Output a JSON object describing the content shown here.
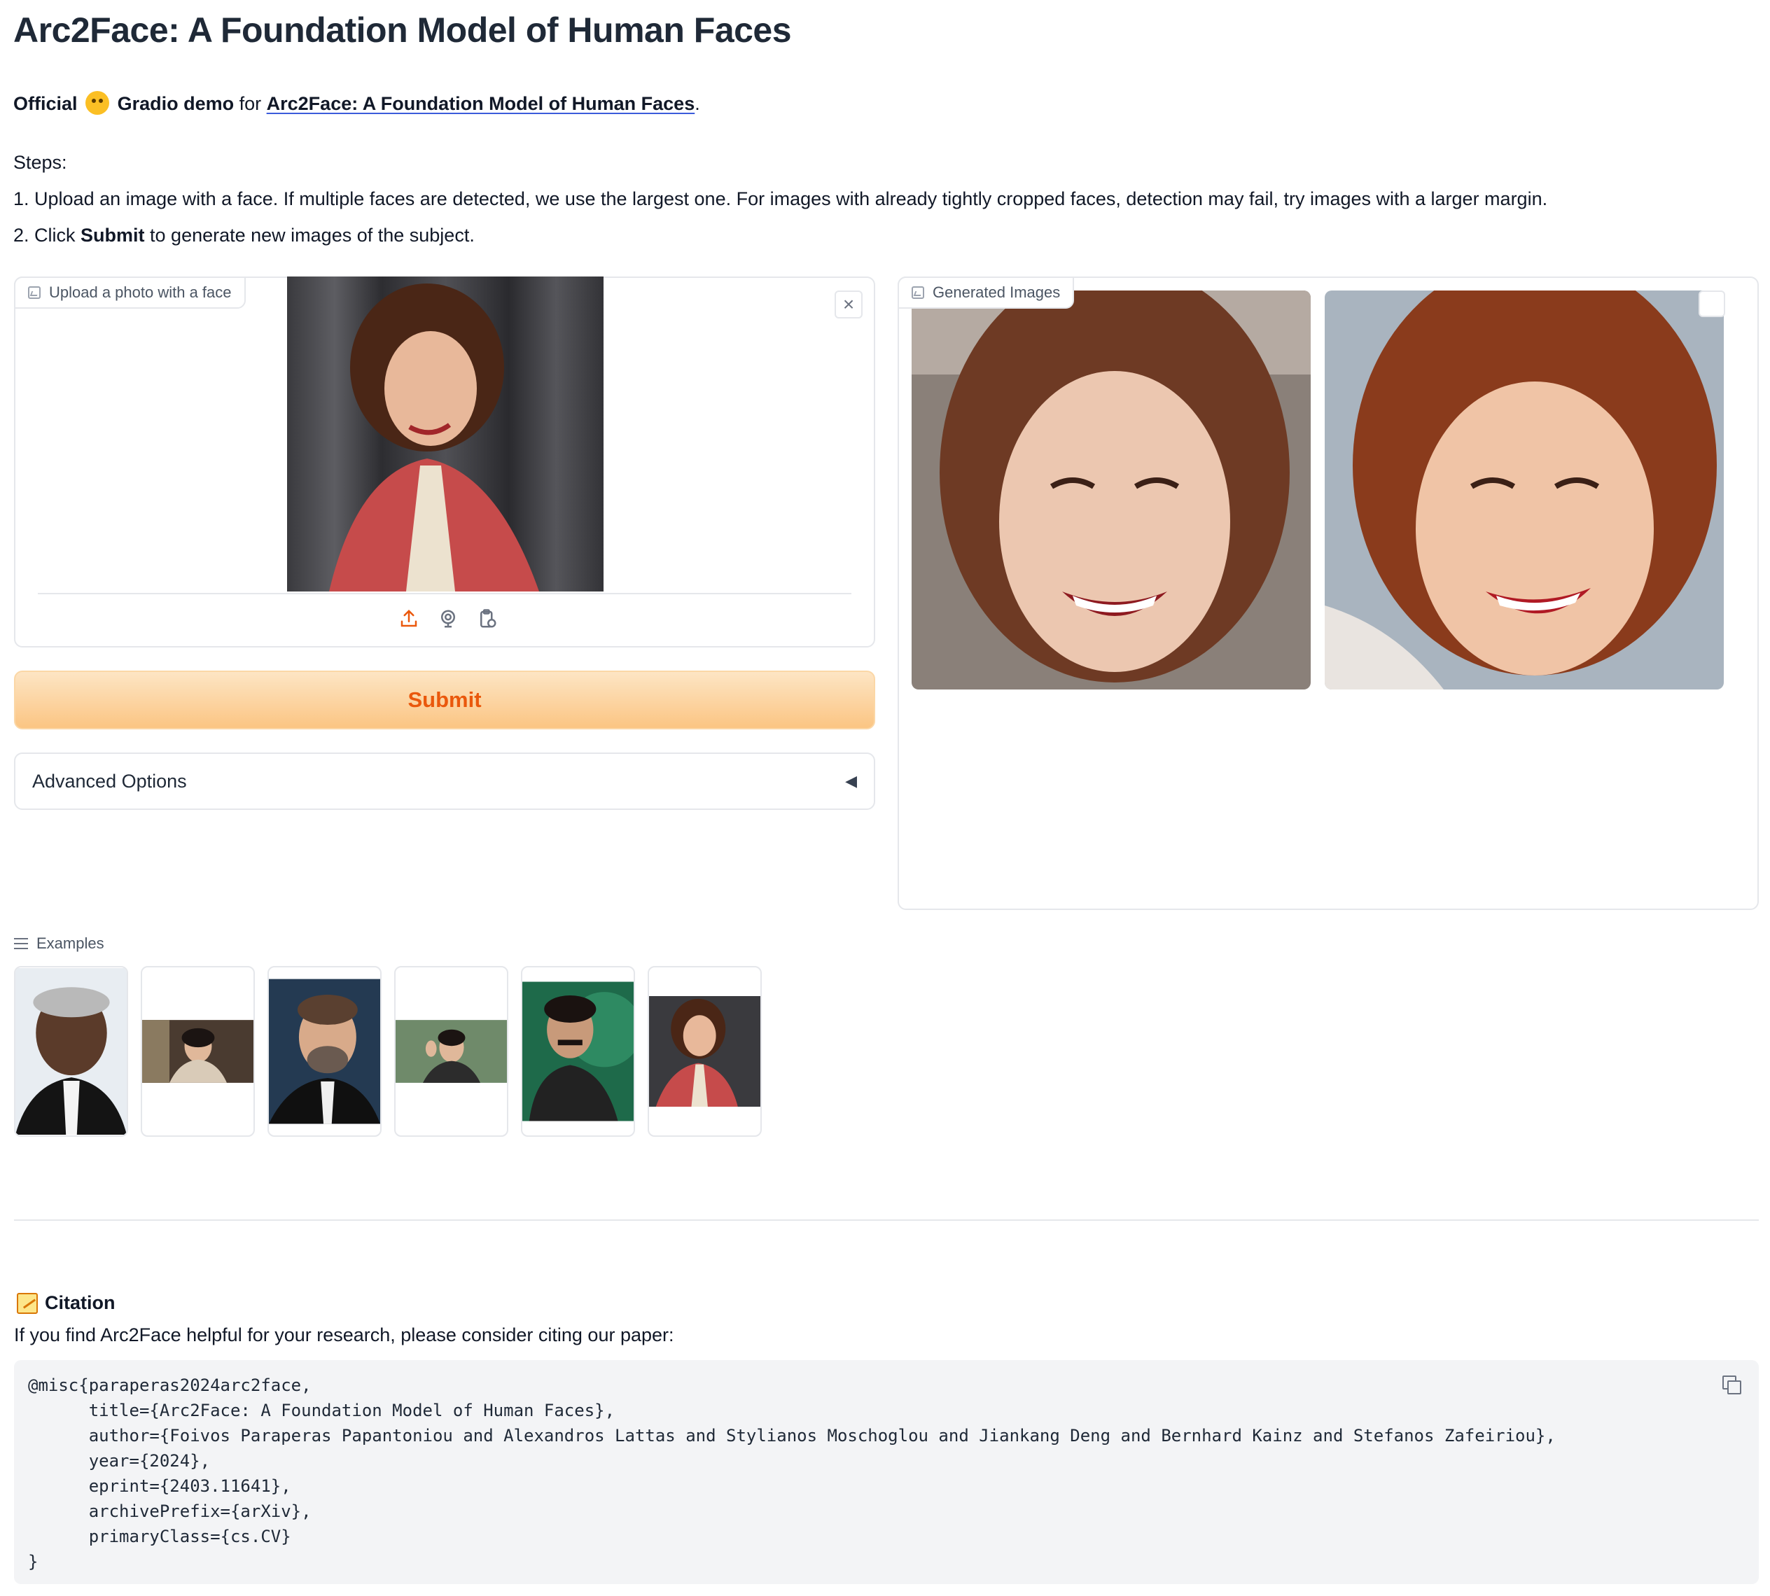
{
  "header": {
    "title": "Arc2Face: A Foundation Model of Human Faces"
  },
  "intro": {
    "official": "Official",
    "gradio_demo": "Gradio demo",
    "for": "for",
    "paper_link": "Arc2Face: A Foundation Model of Human Faces",
    "period": "."
  },
  "steps": {
    "heading": "Steps:",
    "step1": "1. Upload an image with a face. If multiple faces are detected, we use the largest one. For images with already tightly cropped faces, detection may fail, try images with a larger margin.",
    "step2_prefix": "2. Click ",
    "step2_bold": "Submit",
    "step2_suffix": " to generate new images of the subject."
  },
  "upload": {
    "label": "Upload a photo with a face",
    "close_glyph": "×",
    "sources": [
      "upload-icon",
      "webcam-icon",
      "clipboard-icon"
    ]
  },
  "submit_label": "Submit",
  "advanced": {
    "label": "Advanced Options",
    "caret": "◀"
  },
  "generated": {
    "label": "Generated Images"
  },
  "examples": {
    "label": "Examples"
  },
  "citation": {
    "heading": "Citation",
    "sub": "If you find Arc2Face helpful for your research, please consider citing our paper:",
    "code": "@misc{paraperas2024arc2face,\n      title={Arc2Face: A Foundation Model of Human Faces},\n      author={Foivos Paraperas Papantoniou and Alexandros Lattas and Stylianos Moschoglou and Jiankang Deng and Bernhard Kainz and Stefanos Zafeiriou},\n      year={2024},\n      eprint={2403.11641},\n      archivePrefix={arXiv},\n      primaryClass={cs.CV}\n}"
  },
  "colors": {
    "accent": "#ea580c",
    "submit_bg": "#fbc583",
    "border": "#e5e7eb",
    "code_bg": "#f3f4f6"
  }
}
